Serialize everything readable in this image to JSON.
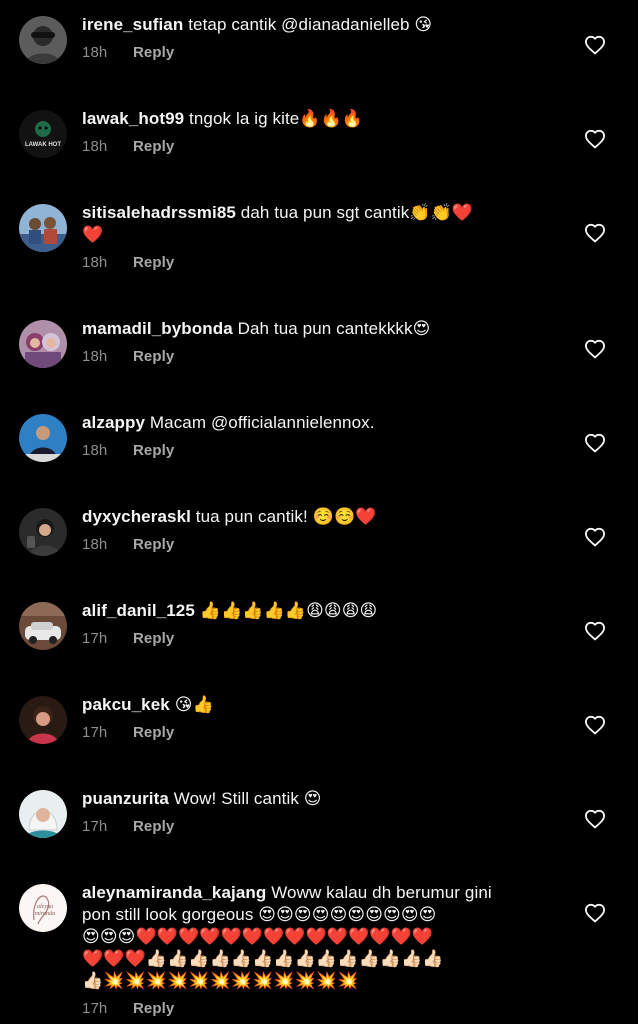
{
  "colors": {
    "background": "#000000",
    "username": "#f5f5f5",
    "text": "#f5f5f5",
    "meta": "#8e8e8e",
    "reply": "#a8a8a8",
    "heart_outline": "#f5f5f5"
  },
  "icons": {
    "like": "heart-outline-icon"
  },
  "comments": [
    {
      "username": "irene_sufian",
      "lines": [
        "tetap cantik @dianadanielleb 😘"
      ],
      "time": "18h",
      "reply": "Reply"
    },
    {
      "username": "lawak_hot99",
      "avatar_text": "LAWAK HOT",
      "lines": [
        "tngok la ig kite🔥🔥🔥"
      ],
      "time": "18h",
      "reply": "Reply"
    },
    {
      "username": "sitisalehadrssmi85",
      "lines": [
        "dah tua pun sgt cantik👏👏❤️",
        "❤️"
      ],
      "time": "18h",
      "reply": "Reply"
    },
    {
      "username": "mamadil_bybonda",
      "lines": [
        "Dah tua pun cantekkkk😍"
      ],
      "time": "18h",
      "reply": "Reply"
    },
    {
      "username": "alzappy",
      "lines": [
        "Macam @officialannielennox."
      ],
      "time": "18h",
      "reply": "Reply"
    },
    {
      "username": "dyxycheraskl",
      "lines": [
        "tua pun cantik! ☺️☺️❤️"
      ],
      "time": "18h",
      "reply": "Reply"
    },
    {
      "username": "alif_danil_125",
      "lines": [
        "👍👍👍👍👍😩😩😩😩"
      ],
      "time": "17h",
      "reply": "Reply"
    },
    {
      "username": "pakcu_kek",
      "lines": [
        "😘👍"
      ],
      "time": "17h",
      "reply": "Reply"
    },
    {
      "username": "puanzurita",
      "lines": [
        "Wow! Still cantik 😍"
      ],
      "time": "17h",
      "reply": "Reply"
    },
    {
      "username": "aleynamiranda_kajang",
      "avatar_text": "aleyna miranda",
      "lines": [
        "Woww kalau dh berumur gini",
        "pon still look gorgeous 😍😍😍😍😍😍😍😍😍😍",
        "😍😍😍❤️❤️❤️❤️❤️❤️❤️❤️❤️❤️❤️❤️❤️❤️",
        "❤️❤️❤️👍🏻👍🏻👍🏻👍🏻👍🏻👍🏻👍🏻👍🏻👍🏻👍🏻👍🏻👍🏻👍🏻👍🏻",
        "👍🏻💥💥💥💥💥💥💥💥💥💥💥💥"
      ],
      "time": "17h",
      "reply": "Reply"
    }
  ]
}
